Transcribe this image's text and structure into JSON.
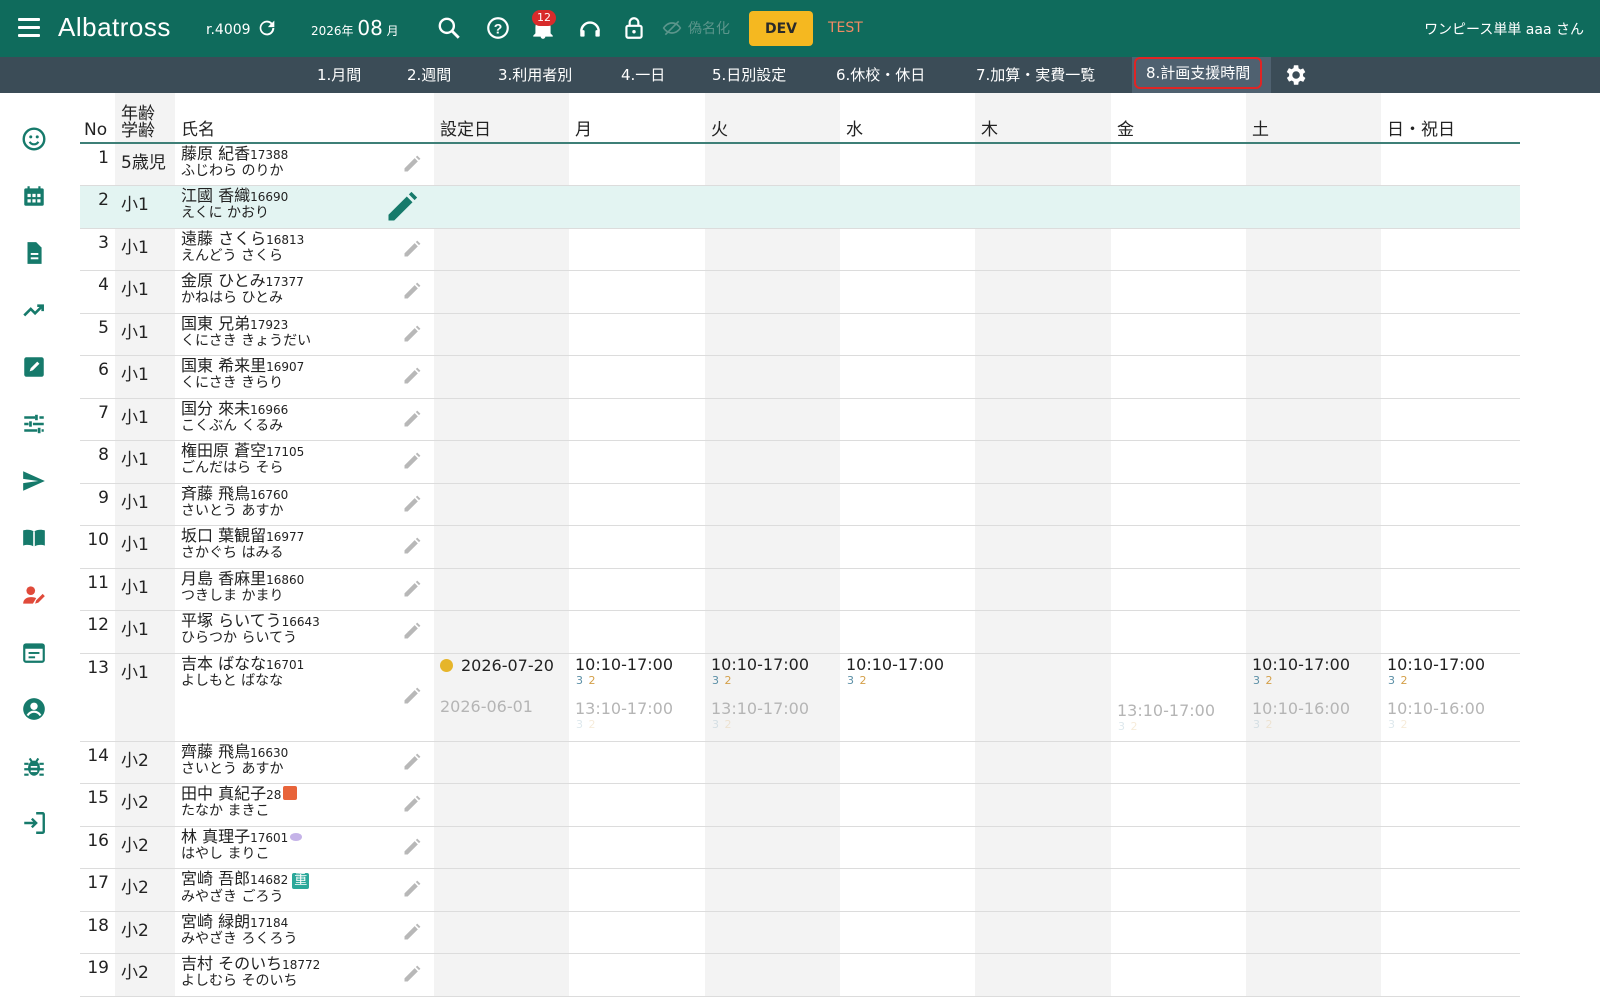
{
  "app": {
    "brand": "Albatross",
    "revision": "r.4009",
    "year_prefix": "2026年",
    "month_num": "08",
    "month_suffix": "月",
    "notification_count": "12",
    "anonymize_label": "偽名化",
    "dev_label": "DEV",
    "test_label": "TEST",
    "user_label": "ワンピース単単 aaa さん"
  },
  "tabs": [
    "1.月間",
    "2.週間",
    "3.利用者別",
    "4.一日",
    "5.日別設定",
    "6.休校・休日",
    "7.加算・実費一覧",
    "8.計画支援時間"
  ],
  "table": {
    "headers": {
      "no": "No",
      "age_top": "年齢",
      "age_bottom": "学齢",
      "name": "氏名",
      "setdate": "設定日",
      "mon": "月",
      "tue": "火",
      "wed": "水",
      "thu": "木",
      "fri": "金",
      "sat": "土",
      "sun": "日・祝日"
    },
    "rows": [
      {
        "no": "1",
        "age": "5歳児",
        "name": "藤原 紀香",
        "id": "17388",
        "kana": "ふじわら のりか"
      },
      {
        "no": "2",
        "age": "小1",
        "name": "江國 香織",
        "id": "16690",
        "kana": "えくに かおり"
      },
      {
        "no": "3",
        "age": "小1",
        "name": "遠藤 さくら",
        "id": "16813",
        "kana": "えんどう さくら"
      },
      {
        "no": "4",
        "age": "小1",
        "name": "金原 ひとみ",
        "id": "17377",
        "kana": "かねはら ひとみ"
      },
      {
        "no": "5",
        "age": "小1",
        "name": "国東 兄弟",
        "id": "17923",
        "kana": "くにさき きょうだい"
      },
      {
        "no": "6",
        "age": "小1",
        "name": "国東 希来里",
        "id": "16907",
        "kana": "くにさき きらり"
      },
      {
        "no": "7",
        "age": "小1",
        "name": "国分 來未",
        "id": "16966",
        "kana": "こくぶん くるみ"
      },
      {
        "no": "8",
        "age": "小1",
        "name": "権田原 蒼空",
        "id": "17105",
        "kana": "ごんだはら そら"
      },
      {
        "no": "9",
        "age": "小1",
        "name": "斉藤 飛鳥",
        "id": "16760",
        "kana": "さいとう あすか"
      },
      {
        "no": "10",
        "age": "小1",
        "name": "坂口 葉観留",
        "id": "16977",
        "kana": "さかぐち はみる"
      },
      {
        "no": "11",
        "age": "小1",
        "name": "月島 香麻里",
        "id": "16860",
        "kana": "つきしま かまり"
      },
      {
        "no": "12",
        "age": "小1",
        "name": "平塚 らいてう",
        "id": "16643",
        "kana": "ひらつか らいてう"
      },
      {
        "no": "13",
        "age": "小1",
        "name": "吉本 ばなな",
        "id": "16701",
        "kana": "よしもと ばなな"
      },
      {
        "no": "14",
        "age": "小2",
        "name": "齊藤 飛鳥",
        "id": "16630",
        "kana": "さいとう あすか"
      },
      {
        "no": "15",
        "age": "小2",
        "name": "田中 真紀子",
        "id": "28",
        "kana": "たなか まきこ"
      },
      {
        "no": "16",
        "age": "小2",
        "name": "林 真理子",
        "id": "17601",
        "kana": "はやし まりこ"
      },
      {
        "no": "17",
        "age": "小2",
        "name": "宮崎 吾郎",
        "id": "14682",
        "kana": "みやざき ごろう",
        "badge": "重"
      },
      {
        "no": "18",
        "age": "小2",
        "name": "宮崎 緑朗",
        "id": "17184",
        "kana": "みやざき ろくろう"
      },
      {
        "no": "19",
        "age": "小2",
        "name": "吉村 そのいち",
        "id": "18772",
        "kana": "よしむら そのいち"
      }
    ],
    "row13": {
      "set_current": "2026-07-20",
      "set_previous": "2026-06-01",
      "mon": "10:10-17:00",
      "tue": "10:10-17:00",
      "wed": "10:10-17:00",
      "sat": "10:10-17:00",
      "sun": "10:10-17:00",
      "mon_prev": "13:10-17:00",
      "tue_prev": "13:10-17:00",
      "fri_prev": "13:10-17:00",
      "sat_prev": "10:10-16:00",
      "sun_prev": "10:10-16:00",
      "chip_a": "3",
      "chip_b": "2"
    }
  },
  "colors": {
    "topbar": "#0f6b5c",
    "tabbar": "#3b4c57",
    "dev": "#f5b820",
    "highlight": "#e02424",
    "sidebar_active": "#e04a3a"
  }
}
